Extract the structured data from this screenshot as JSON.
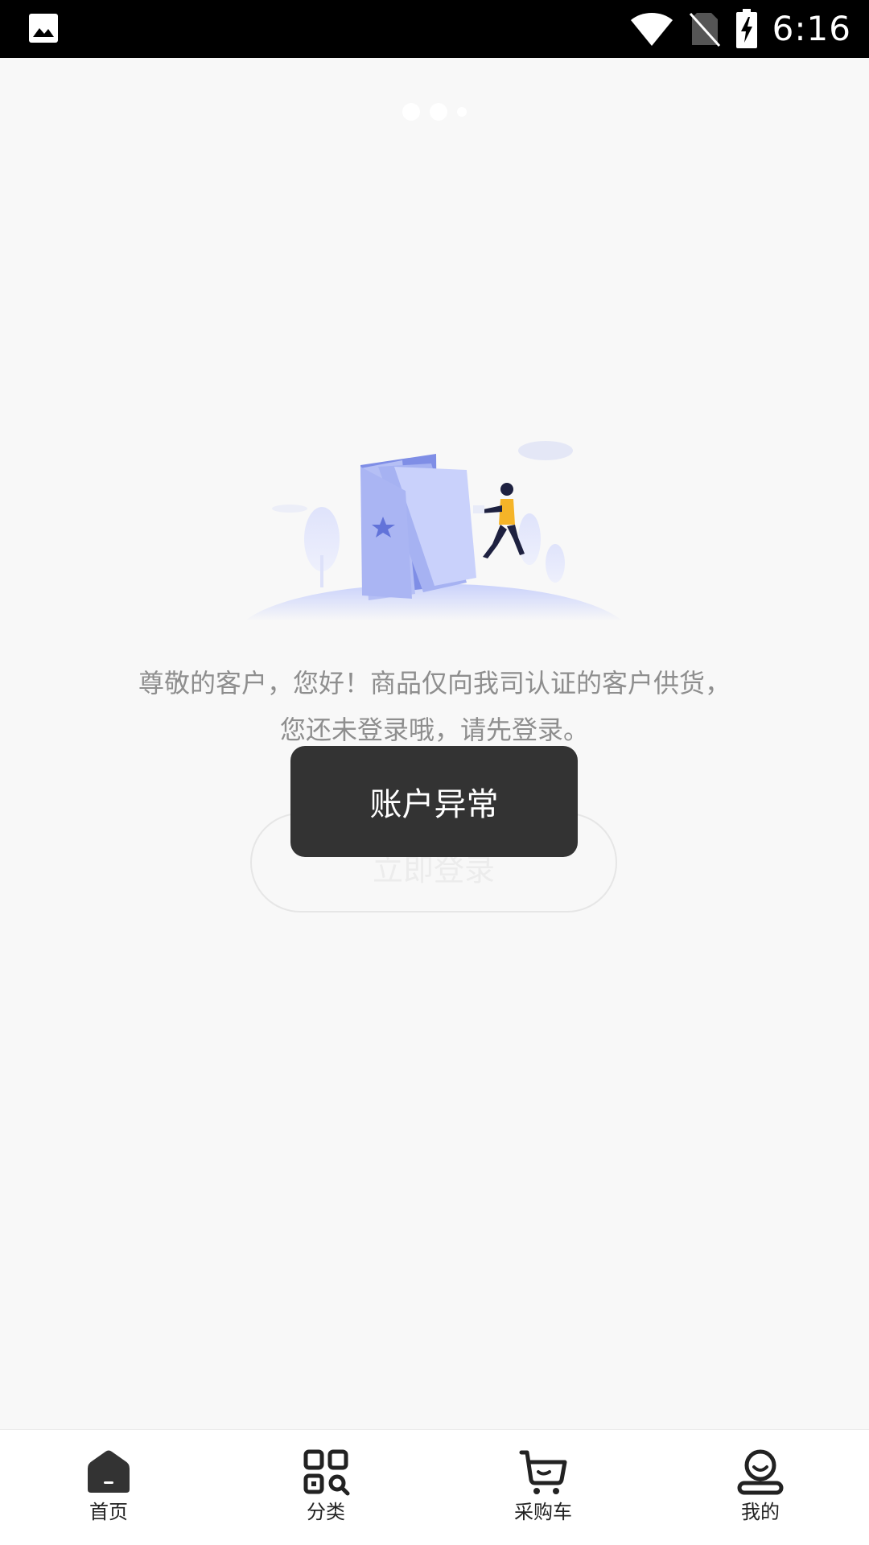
{
  "status_bar": {
    "time": "6:16",
    "icons": [
      "image-icon",
      "wifi-icon",
      "no-sim-icon",
      "battery-charging-icon"
    ]
  },
  "main": {
    "message": "尊敬的客户，您好！商品仅向我司认证的客户供货，您还未登录哦，请先登录。",
    "login_button_label": "立即登录"
  },
  "toast": {
    "text": "账户异常"
  },
  "bottom_nav": {
    "items": [
      {
        "label": "首页",
        "icon": "home-icon",
        "active": true
      },
      {
        "label": "分类",
        "icon": "category-grid-icon",
        "active": false
      },
      {
        "label": "采购车",
        "icon": "cart-icon",
        "active": false
      },
      {
        "label": "我的",
        "icon": "profile-icon",
        "active": false
      }
    ]
  },
  "colors": {
    "background": "#f8f8f8",
    "toast_bg": "#333333",
    "message_text": "#8e8e8e",
    "illustration_accent": "#6f7fe0"
  }
}
